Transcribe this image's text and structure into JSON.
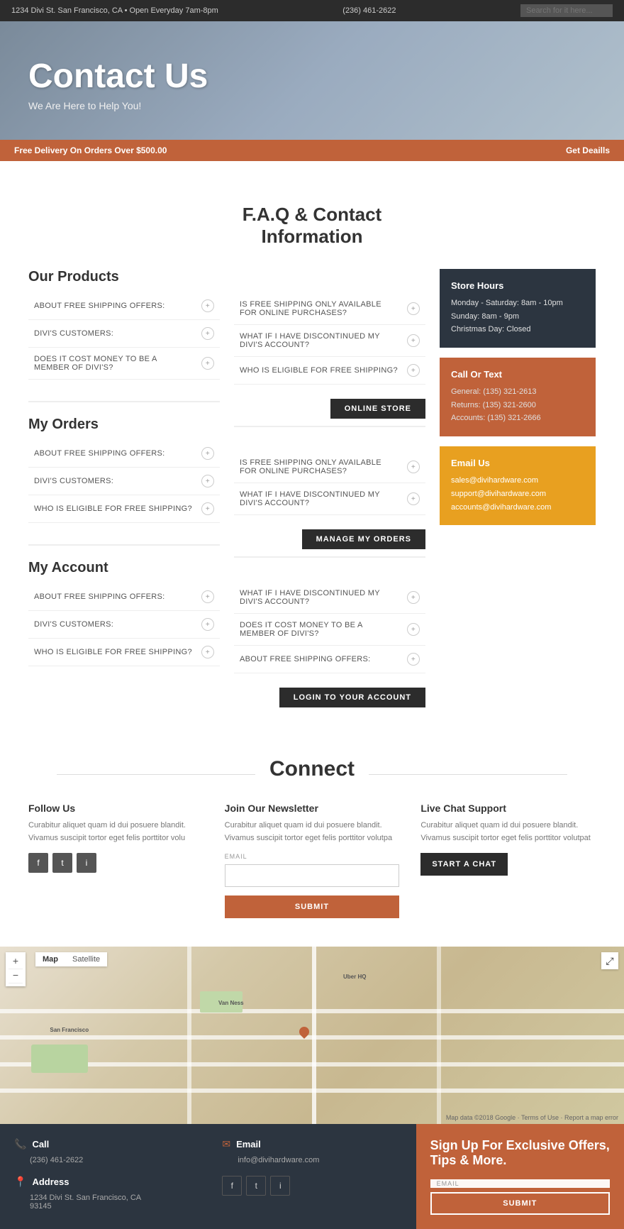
{
  "topbar": {
    "address": "1234 Divi St. San Francisco, CA • Open Everyday 7am-8pm",
    "phone": "(236) 461-2622",
    "search_placeholder": "Search for it here..."
  },
  "hero": {
    "title": "Contact Us",
    "subtitle": "We Are Here to Help You!"
  },
  "promo": {
    "text": "Free Delivery On Orders Over $500.00",
    "cta": "Get Deaills"
  },
  "faq_section": {
    "main_title": "F.A.Q & Contact",
    "main_title2": "Information"
  },
  "products_section": {
    "title": "Our Products",
    "left_items": [
      {
        "label": "About Free Shipping Offers:"
      },
      {
        "label": "Divi's Customers:"
      },
      {
        "label": "Does It Cost Money To Be A Member Of Divi's?"
      }
    ],
    "right_items": [
      {
        "label": "Is Free Shipping Only Available For Online Purchases?"
      },
      {
        "label": "What If I Have Discontinued My Divi's Account?"
      },
      {
        "label": "Who Is Eligible For Free Shipping?"
      }
    ],
    "button": "Online Store"
  },
  "orders_section": {
    "title": "My Orders",
    "left_items": [
      {
        "label": "About Free Shipping Offers:"
      },
      {
        "label": "Divi's Customers:"
      },
      {
        "label": "Who Is Eligible For Free Shipping?"
      }
    ],
    "right_items": [
      {
        "label": "Is Free Shipping Only Available For Online Purchases?"
      },
      {
        "label": "What If I Have Discontinued My Divi's Account?"
      }
    ],
    "button": "Manage My Orders"
  },
  "account_section": {
    "title": "My Account",
    "left_items": [
      {
        "label": "About Free Shipping Offers:"
      },
      {
        "label": "Divi's Customers:"
      },
      {
        "label": "Who Is Eligible For Free Shipping?"
      }
    ],
    "right_items": [
      {
        "label": "What If I Have Discontinued My Divi's Account?"
      },
      {
        "label": "Does It Cost Money To Be A Member Of Divi's?"
      },
      {
        "label": "About Free Shipping Offers:"
      }
    ],
    "button": "Login To Your Account"
  },
  "sidebar": {
    "store_hours": {
      "title": "Store Hours",
      "mon_sat": "Monday - Saturday: 8am - 10pm",
      "sunday": "Sunday: 8am - 9pm",
      "christmas": "Christmas Day: Closed"
    },
    "call_text": {
      "title": "Call Or Text",
      "general": "General: (135) 321-2613",
      "returns": "Returns: (135) 321-2600",
      "accounts": "Accounts: (135) 321-2666"
    },
    "email_us": {
      "title": "Email Us",
      "sales": "sales@divihardware.com",
      "support": "support@divihardware.com",
      "accounts": "accounts@divihardware.com"
    }
  },
  "connect": {
    "title": "Connect",
    "follow_us": {
      "title": "Follow Us",
      "body": "Curabitur aliquet quam id dui posuere blandit. Vivamus suscipit tortor eget felis porttitor volu",
      "social": [
        "f",
        "t",
        "i"
      ]
    },
    "newsletter": {
      "title": "Join Our Newsletter",
      "body": "Curabitur aliquet quam id dui posuere blandit. Vivamus suscipit tortor eget felis porttitor volutpa",
      "email_placeholder": "EMAIL",
      "submit_label": "Submit"
    },
    "live_chat": {
      "title": "Live Chat Support",
      "body": "Curabitur aliquet quam id dui posuere blandit. Vivamus suscipit tortor eget felis porttitor volutpat",
      "button": "Start A Chat"
    }
  },
  "map": {
    "tab_map": "Map",
    "tab_satellite": "Satellite"
  },
  "footer": {
    "call": {
      "title": "Call",
      "number": "(236) 461-2622"
    },
    "email": {
      "title": "Email",
      "address": "info@divihardware.com",
      "social": [
        "f",
        "t",
        "i"
      ]
    },
    "address": {
      "title": "Address",
      "line1": "1234 Divi St. San Francisco, CA",
      "line2": "93145"
    },
    "signup": {
      "title": "Sign Up For Exclusive Offers, Tips & More.",
      "email_placeholder": "EMAIL",
      "submit_label": "Submit"
    }
  }
}
